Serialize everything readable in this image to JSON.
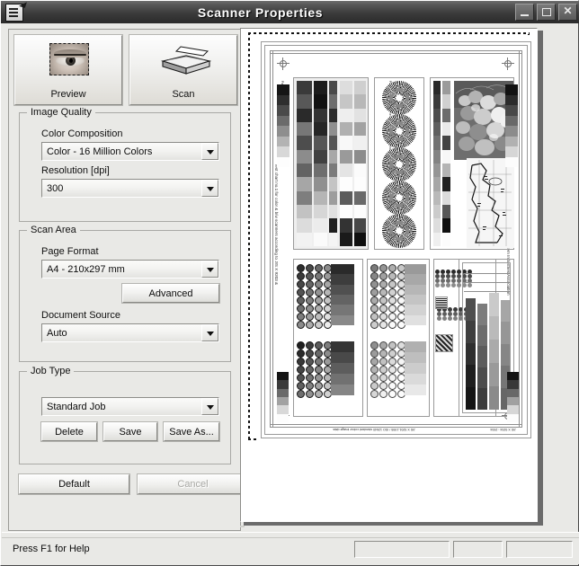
{
  "window": {
    "title": "Scanner Properties",
    "icon": "scanner-document-icon",
    "controls": {
      "minimize": "–",
      "maximize": "□",
      "close": "✕"
    }
  },
  "actions": {
    "preview": {
      "label": "Preview",
      "icon": "eye-selection-icon"
    },
    "scan": {
      "label": "Scan",
      "icon": "flatbed-scanner-icon"
    }
  },
  "image_quality": {
    "title": "Image Quality",
    "color_composition": {
      "label": "Color Composition",
      "value": "Color - 16 Million Colors"
    },
    "resolution": {
      "label": "Resolution [dpi]",
      "value": "300"
    }
  },
  "scan_area": {
    "title": "Scan Area",
    "page_format": {
      "label": "Page Format",
      "value": "A4 - 210x297 mm"
    },
    "advanced_label": "Advanced",
    "document_source": {
      "label": "Document Source",
      "value": "Auto"
    }
  },
  "job_type": {
    "title": "Job Type",
    "job": {
      "value": "Standard Job"
    },
    "delete_label": "Delete",
    "save_label": "Save",
    "save_as_label": "Save As..."
  },
  "dialog_buttons": {
    "default_label": "Default",
    "cancel_label": "Cancel",
    "cancel_disabled": true
  },
  "preview": {
    "selection": "marching-ants-selection",
    "content_description": "Scanned colour test chart target"
  },
  "status_bar": {
    "help_text": "Press F1 for Help",
    "panels": [
      "",
      "",
      ""
    ]
  },
  "colors": {
    "window_face": "#e9e9e6",
    "titlebar_dark": "#2b2b2b",
    "titlebar_light": "#6e6e6e",
    "title_text": "#ffffff",
    "border_dark": "#8d8d89",
    "border_light": "#ffffff",
    "disabled_text": "#a8a8a4",
    "preview_shadow": "#6b6b6b"
  }
}
